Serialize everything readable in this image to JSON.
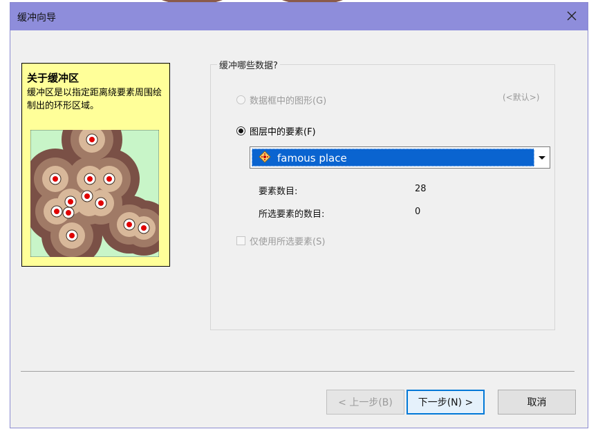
{
  "window": {
    "title": "缓冲向导"
  },
  "info_panel": {
    "title": "关于缓冲区",
    "description": "缓冲区是以指定距离绕要素周围绘制出的环形区域。"
  },
  "group": {
    "legend": "缓冲哪些数据?",
    "option_graphics": "数据框中的图形(G)",
    "default_tag": "(<默认>)",
    "option_layer": "图层中的要素(F)",
    "layer_select_value": "famous place",
    "feature_count_label": "要素数目:",
    "feature_count_value": "28",
    "selected_count_label": "所选要素的数目:",
    "selected_count_value": "0",
    "selected_only_label": "仅使用所选要素(S)"
  },
  "buttons": {
    "back": "< 上一步(B)",
    "next": "下一步(N) >",
    "cancel": "取消"
  },
  "state": {
    "selected_radio": "option_layer",
    "graphics_enabled": false,
    "selected_only_checked": false,
    "selected_only_enabled": false,
    "back_enabled": false
  },
  "colors": {
    "titlebar": "#8e8ddb",
    "info_panel_bg": "#ffff99",
    "selection": "#0a64d0",
    "primary_border": "#0078d7"
  },
  "icons": {
    "close": "close-icon",
    "layer": "point-layer-icon",
    "dropdown": "chevron-down-icon"
  }
}
